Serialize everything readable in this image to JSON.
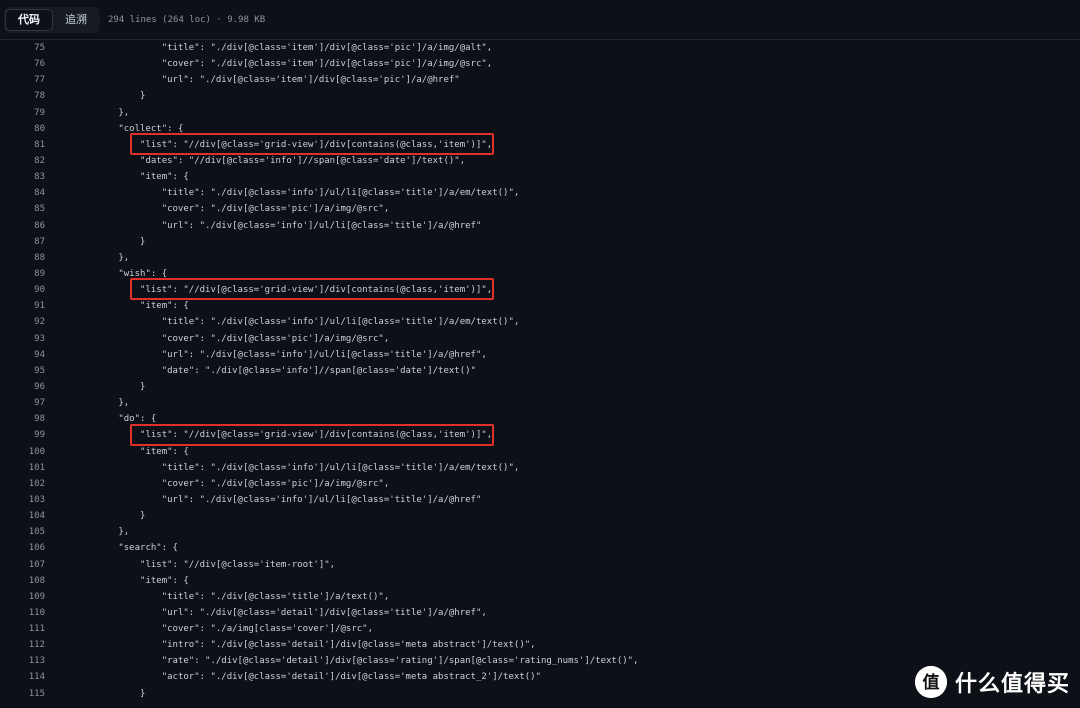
{
  "toolbar": {
    "tabs": [
      {
        "label": "代码",
        "active": true
      },
      {
        "label": "追溯",
        "active": false
      }
    ],
    "file_info": "294 lines (264 loc) · 9.98 KB"
  },
  "code_lines": [
    {
      "n": "75",
      "text": "                \"title\": \"./div[@class='item']/div[@class='pic']/a/img/@alt\","
    },
    {
      "n": "76",
      "text": "                \"cover\": \"./div[@class='item']/div[@class='pic']/a/img/@src\","
    },
    {
      "n": "77",
      "text": "                \"url\": \"./div[@class='item']/div[@class='pic']/a/@href\""
    },
    {
      "n": "78",
      "text": "            }"
    },
    {
      "n": "79",
      "text": "        },"
    },
    {
      "n": "80",
      "text": "        \"collect\": {"
    },
    {
      "n": "81",
      "text": "            \"list\": \"//div[@class='grid-view']/div[contains(@class,'item')]\","
    },
    {
      "n": "82",
      "text": "            \"dates\": \"//div[@class='info']//span[@class='date']/text()\","
    },
    {
      "n": "83",
      "text": "            \"item\": {"
    },
    {
      "n": "84",
      "text": "                \"title\": \"./div[@class='info']/ul/li[@class='title']/a/em/text()\","
    },
    {
      "n": "85",
      "text": "                \"cover\": \"./div[@class='pic']/a/img/@src\","
    },
    {
      "n": "86",
      "text": "                \"url\": \"./div[@class='info']/ul/li[@class='title']/a/@href\""
    },
    {
      "n": "87",
      "text": "            }"
    },
    {
      "n": "88",
      "text": "        },"
    },
    {
      "n": "89",
      "text": "        \"wish\": {"
    },
    {
      "n": "90",
      "text": "            \"list\": \"//div[@class='grid-view']/div[contains(@class,'item')]\","
    },
    {
      "n": "91",
      "text": "            \"item\": {"
    },
    {
      "n": "92",
      "text": "                \"title\": \"./div[@class='info']/ul/li[@class='title']/a/em/text()\","
    },
    {
      "n": "93",
      "text": "                \"cover\": \"./div[@class='pic']/a/img/@src\","
    },
    {
      "n": "94",
      "text": "                \"url\": \"./div[@class='info']/ul/li[@class='title']/a/@href\","
    },
    {
      "n": "95",
      "text": "                \"date\": \"./div[@class='info']//span[@class='date']/text()\""
    },
    {
      "n": "96",
      "text": "            }"
    },
    {
      "n": "97",
      "text": "        },"
    },
    {
      "n": "98",
      "text": "        \"do\": {"
    },
    {
      "n": "99",
      "text": "            \"list\": \"//div[@class='grid-view']/div[contains(@class,'item')]\","
    },
    {
      "n": "100",
      "text": "            \"item\": {"
    },
    {
      "n": "101",
      "text": "                \"title\": \"./div[@class='info']/ul/li[@class='title']/a/em/text()\","
    },
    {
      "n": "102",
      "text": "                \"cover\": \"./div[@class='pic']/a/img/@src\","
    },
    {
      "n": "103",
      "text": "                \"url\": \"./div[@class='info']/ul/li[@class='title']/a/@href\""
    },
    {
      "n": "104",
      "text": "            }"
    },
    {
      "n": "105",
      "text": "        },"
    },
    {
      "n": "106",
      "text": "        \"search\": {"
    },
    {
      "n": "107",
      "text": "            \"list\": \"//div[@class='item-root']\","
    },
    {
      "n": "108",
      "text": "            \"item\": {"
    },
    {
      "n": "109",
      "text": "                \"title\": \"./div[@class='title']/a/text()\","
    },
    {
      "n": "110",
      "text": "                \"url\": \"./div[@class='detail']/div[@class='title']/a/@href\","
    },
    {
      "n": "111",
      "text": "                \"cover\": \"./a/img[class='cover']/@src\","
    },
    {
      "n": "112",
      "text": "                \"intro\": \"./div[@class='detail']/div[@class='meta abstract']/text()\","
    },
    {
      "n": "113",
      "text": "                \"rate\": \"./div[@class='detail']/div[@class='rating']/span[@class='rating_nums']/text()\","
    },
    {
      "n": "114",
      "text": "                \"actor\": \"./div[@class='detail']/div[@class='meta abstract_2']/text()\""
    },
    {
      "n": "115",
      "text": "            }"
    }
  ],
  "highlighted_lines": [
    "81",
    "90",
    "99"
  ],
  "watermark": {
    "logo": "值",
    "text": "什么值得买"
  },
  "colors": {
    "background": "#0d1117",
    "line_number": "#8b949e",
    "code_text": "#c9d1d9",
    "string": "#a5d6ff",
    "highlight_box": "#e0302a"
  }
}
